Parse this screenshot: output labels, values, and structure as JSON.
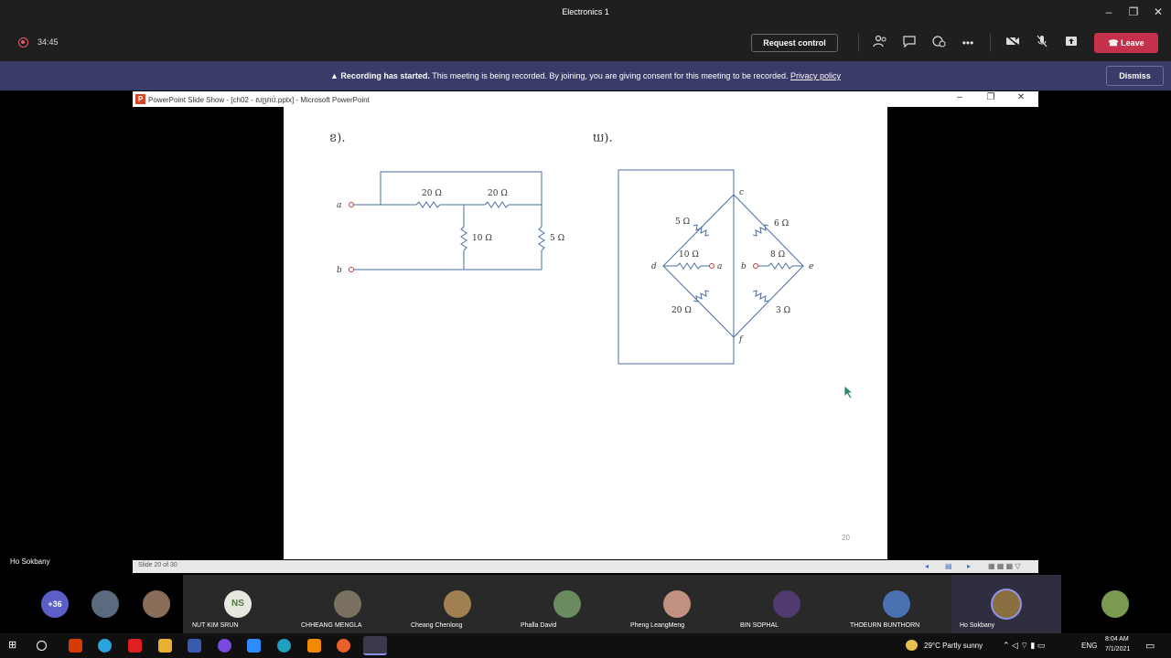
{
  "window": {
    "title": "Electronics 1"
  },
  "meeting": {
    "timer": "34:45",
    "request_control": "Request control",
    "leave": "Leave"
  },
  "banner": {
    "bold": "Recording has started.",
    "text": "This meeting is being recorded. By joining, you are giving consent for this meeting to be recorded.",
    "link": "Privacy policy",
    "dismiss": "Dismiss"
  },
  "ppt": {
    "title": "PowerPoint Slide Show - [ch02 - សម្រាប់.pptx] - Microsoft PowerPoint",
    "slide_status": "Slide 20 of 30",
    "page_number": "20"
  },
  "slide": {
    "label_a": "ខ).",
    "label_b": "ឃ).",
    "circuit1": {
      "terminal_a": "a",
      "terminal_b": "b",
      "r1": "20 Ω",
      "r2": "20 Ω",
      "r3": "10 Ω",
      "r4": "5 Ω"
    },
    "circuit2": {
      "node_c": "c",
      "node_d": "d",
      "node_e": "e",
      "node_f": "f",
      "node_a": "a",
      "node_b": "b",
      "r_5": "5 Ω",
      "r_6": "6 Ω",
      "r_10": "10 Ω",
      "r_8": "8 Ω",
      "r_20": "20 Ω",
      "r_3": "3 Ω"
    }
  },
  "presenter": {
    "name": "Ho Sokbany"
  },
  "participants": {
    "overflow": "+36",
    "list": [
      {
        "name": "NUT KIM SRUN",
        "initials": "NS"
      },
      {
        "name": "CHHEANG MENGLA"
      },
      {
        "name": "Cheang Chenlong"
      },
      {
        "name": "Phalla David"
      },
      {
        "name": "Pheng LeangMeng"
      },
      {
        "name": "BIN SOPHAL"
      },
      {
        "name": "THOEURN BUNTHORN"
      },
      {
        "name": "Ho Sokbany"
      }
    ]
  },
  "taskbar": {
    "weather": "29°C  Partly sunny",
    "lang": "ENG",
    "time": "8:04 AM",
    "date": "7/1/2021"
  }
}
